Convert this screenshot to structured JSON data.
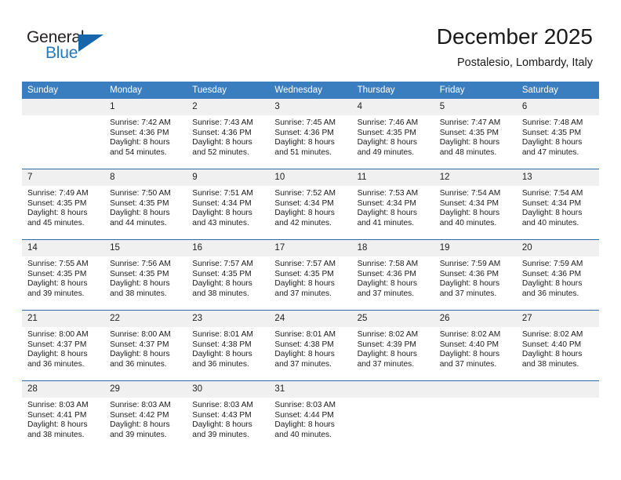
{
  "brand": {
    "name_part1": "General",
    "name_part2": "Blue",
    "accent_color": "#1766ab",
    "text_color": "#231f20"
  },
  "header": {
    "title": "December 2025",
    "subtitle": "Postalesio, Lombardy, Italy"
  },
  "theme": {
    "header_row_bg": "#3b7ec0",
    "row_divider": "#2a6ba8",
    "daynum_bg": "#f0f0f0"
  },
  "weekdays": [
    "Sunday",
    "Monday",
    "Tuesday",
    "Wednesday",
    "Thursday",
    "Friday",
    "Saturday"
  ],
  "weeks": [
    [
      {
        "day": "",
        "blank": true
      },
      {
        "day": "1",
        "sunrise": "Sunrise: 7:42 AM",
        "sunset": "Sunset: 4:36 PM",
        "daylight1": "Daylight: 8 hours",
        "daylight2": "and 54 minutes."
      },
      {
        "day": "2",
        "sunrise": "Sunrise: 7:43 AM",
        "sunset": "Sunset: 4:36 PM",
        "daylight1": "Daylight: 8 hours",
        "daylight2": "and 52 minutes."
      },
      {
        "day": "3",
        "sunrise": "Sunrise: 7:45 AM",
        "sunset": "Sunset: 4:36 PM",
        "daylight1": "Daylight: 8 hours",
        "daylight2": "and 51 minutes."
      },
      {
        "day": "4",
        "sunrise": "Sunrise: 7:46 AM",
        "sunset": "Sunset: 4:35 PM",
        "daylight1": "Daylight: 8 hours",
        "daylight2": "and 49 minutes."
      },
      {
        "day": "5",
        "sunrise": "Sunrise: 7:47 AM",
        "sunset": "Sunset: 4:35 PM",
        "daylight1": "Daylight: 8 hours",
        "daylight2": "and 48 minutes."
      },
      {
        "day": "6",
        "sunrise": "Sunrise: 7:48 AM",
        "sunset": "Sunset: 4:35 PM",
        "daylight1": "Daylight: 8 hours",
        "daylight2": "and 47 minutes."
      }
    ],
    [
      {
        "day": "7",
        "sunrise": "Sunrise: 7:49 AM",
        "sunset": "Sunset: 4:35 PM",
        "daylight1": "Daylight: 8 hours",
        "daylight2": "and 45 minutes."
      },
      {
        "day": "8",
        "sunrise": "Sunrise: 7:50 AM",
        "sunset": "Sunset: 4:35 PM",
        "daylight1": "Daylight: 8 hours",
        "daylight2": "and 44 minutes."
      },
      {
        "day": "9",
        "sunrise": "Sunrise: 7:51 AM",
        "sunset": "Sunset: 4:34 PM",
        "daylight1": "Daylight: 8 hours",
        "daylight2": "and 43 minutes."
      },
      {
        "day": "10",
        "sunrise": "Sunrise: 7:52 AM",
        "sunset": "Sunset: 4:34 PM",
        "daylight1": "Daylight: 8 hours",
        "daylight2": "and 42 minutes."
      },
      {
        "day": "11",
        "sunrise": "Sunrise: 7:53 AM",
        "sunset": "Sunset: 4:34 PM",
        "daylight1": "Daylight: 8 hours",
        "daylight2": "and 41 minutes."
      },
      {
        "day": "12",
        "sunrise": "Sunrise: 7:54 AM",
        "sunset": "Sunset: 4:34 PM",
        "daylight1": "Daylight: 8 hours",
        "daylight2": "and 40 minutes."
      },
      {
        "day": "13",
        "sunrise": "Sunrise: 7:54 AM",
        "sunset": "Sunset: 4:34 PM",
        "daylight1": "Daylight: 8 hours",
        "daylight2": "and 40 minutes."
      }
    ],
    [
      {
        "day": "14",
        "sunrise": "Sunrise: 7:55 AM",
        "sunset": "Sunset: 4:35 PM",
        "daylight1": "Daylight: 8 hours",
        "daylight2": "and 39 minutes."
      },
      {
        "day": "15",
        "sunrise": "Sunrise: 7:56 AM",
        "sunset": "Sunset: 4:35 PM",
        "daylight1": "Daylight: 8 hours",
        "daylight2": "and 38 minutes."
      },
      {
        "day": "16",
        "sunrise": "Sunrise: 7:57 AM",
        "sunset": "Sunset: 4:35 PM",
        "daylight1": "Daylight: 8 hours",
        "daylight2": "and 38 minutes."
      },
      {
        "day": "17",
        "sunrise": "Sunrise: 7:57 AM",
        "sunset": "Sunset: 4:35 PM",
        "daylight1": "Daylight: 8 hours",
        "daylight2": "and 37 minutes."
      },
      {
        "day": "18",
        "sunrise": "Sunrise: 7:58 AM",
        "sunset": "Sunset: 4:36 PM",
        "daylight1": "Daylight: 8 hours",
        "daylight2": "and 37 minutes."
      },
      {
        "day": "19",
        "sunrise": "Sunrise: 7:59 AM",
        "sunset": "Sunset: 4:36 PM",
        "daylight1": "Daylight: 8 hours",
        "daylight2": "and 37 minutes."
      },
      {
        "day": "20",
        "sunrise": "Sunrise: 7:59 AM",
        "sunset": "Sunset: 4:36 PM",
        "daylight1": "Daylight: 8 hours",
        "daylight2": "and 36 minutes."
      }
    ],
    [
      {
        "day": "21",
        "sunrise": "Sunrise: 8:00 AM",
        "sunset": "Sunset: 4:37 PM",
        "daylight1": "Daylight: 8 hours",
        "daylight2": "and 36 minutes."
      },
      {
        "day": "22",
        "sunrise": "Sunrise: 8:00 AM",
        "sunset": "Sunset: 4:37 PM",
        "daylight1": "Daylight: 8 hours",
        "daylight2": "and 36 minutes."
      },
      {
        "day": "23",
        "sunrise": "Sunrise: 8:01 AM",
        "sunset": "Sunset: 4:38 PM",
        "daylight1": "Daylight: 8 hours",
        "daylight2": "and 36 minutes."
      },
      {
        "day": "24",
        "sunrise": "Sunrise: 8:01 AM",
        "sunset": "Sunset: 4:38 PM",
        "daylight1": "Daylight: 8 hours",
        "daylight2": "and 37 minutes."
      },
      {
        "day": "25",
        "sunrise": "Sunrise: 8:02 AM",
        "sunset": "Sunset: 4:39 PM",
        "daylight1": "Daylight: 8 hours",
        "daylight2": "and 37 minutes."
      },
      {
        "day": "26",
        "sunrise": "Sunrise: 8:02 AM",
        "sunset": "Sunset: 4:40 PM",
        "daylight1": "Daylight: 8 hours",
        "daylight2": "and 37 minutes."
      },
      {
        "day": "27",
        "sunrise": "Sunrise: 8:02 AM",
        "sunset": "Sunset: 4:40 PM",
        "daylight1": "Daylight: 8 hours",
        "daylight2": "and 38 minutes."
      }
    ],
    [
      {
        "day": "28",
        "sunrise": "Sunrise: 8:03 AM",
        "sunset": "Sunset: 4:41 PM",
        "daylight1": "Daylight: 8 hours",
        "daylight2": "and 38 minutes."
      },
      {
        "day": "29",
        "sunrise": "Sunrise: 8:03 AM",
        "sunset": "Sunset: 4:42 PM",
        "daylight1": "Daylight: 8 hours",
        "daylight2": "and 39 minutes."
      },
      {
        "day": "30",
        "sunrise": "Sunrise: 8:03 AM",
        "sunset": "Sunset: 4:43 PM",
        "daylight1": "Daylight: 8 hours",
        "daylight2": "and 39 minutes."
      },
      {
        "day": "31",
        "sunrise": "Sunrise: 8:03 AM",
        "sunset": "Sunset: 4:44 PM",
        "daylight1": "Daylight: 8 hours",
        "daylight2": "and 40 minutes."
      },
      {
        "day": "",
        "blank": true
      },
      {
        "day": "",
        "blank": true
      },
      {
        "day": "",
        "blank": true
      }
    ]
  ]
}
